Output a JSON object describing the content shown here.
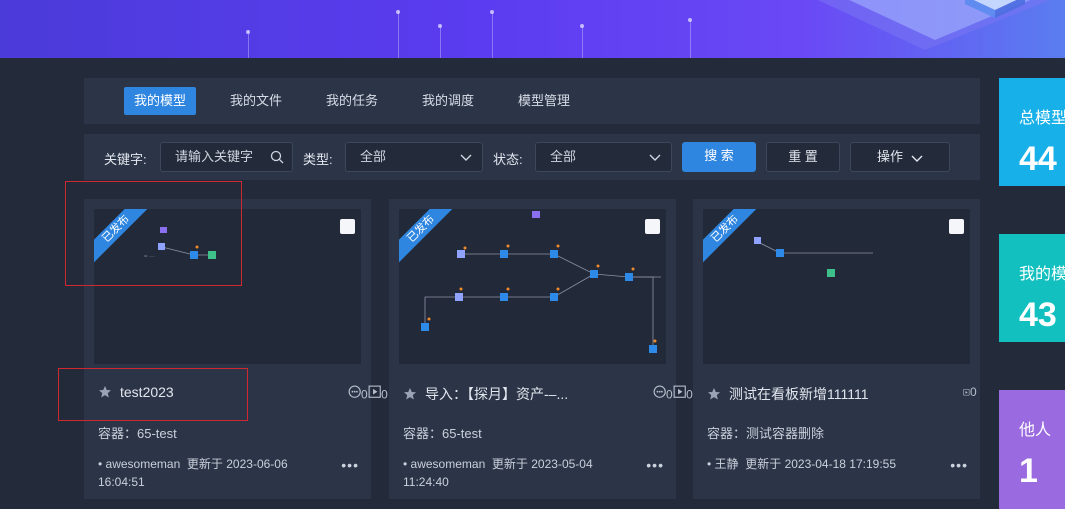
{
  "tabs": [
    {
      "label": "我的模型",
      "active": true
    },
    {
      "label": "我的文件",
      "active": false
    },
    {
      "label": "我的任务",
      "active": false
    },
    {
      "label": "我的调度",
      "active": false
    },
    {
      "label": "模型管理",
      "active": false
    }
  ],
  "filter": {
    "keyword_label": "关键字:",
    "keyword_placeholder": "请输入关键字",
    "type_label": "类型:",
    "type_value": "全部",
    "status_label": "状态:",
    "status_value": "全部",
    "search_label": "搜 索",
    "reset_label": "重 置",
    "actions_label": "操作"
  },
  "cards": [
    {
      "badge": "已发布",
      "title": "test2023",
      "comments": "0",
      "runs": "0",
      "container": "容器：65-test",
      "author": "awesomeman",
      "updated": "更新于 2023-06-06 16:04:51",
      "more": "•••"
    },
    {
      "badge": "已发布",
      "title": "导入：【探月】资产-–...",
      "comments": "0",
      "runs": "0",
      "container": "容器：65-test",
      "author": "awesomeman",
      "updated": "更新于 2023-05-04 11:24:40",
      "more": "•••"
    },
    {
      "badge": "已发布",
      "title": "测试在看板新增111111",
      "runs": "0",
      "container": "容器：测试容器删除",
      "author": "王静",
      "updated": "更新于 2023-04-18 17:19:55",
      "more": "•••"
    }
  ],
  "side_stats": [
    {
      "title": "总模型",
      "value": "44",
      "color": "#18b0e8"
    },
    {
      "title": "我的模",
      "value": "43",
      "color": "#12c0c0"
    },
    {
      "title": "他人",
      "value": "1",
      "color": "#9a6ae0"
    }
  ],
  "colors": {
    "accent": "#2f86e0",
    "highlight": "#d0282e",
    "background": "#232b3a",
    "panel": "#2c3547"
  }
}
